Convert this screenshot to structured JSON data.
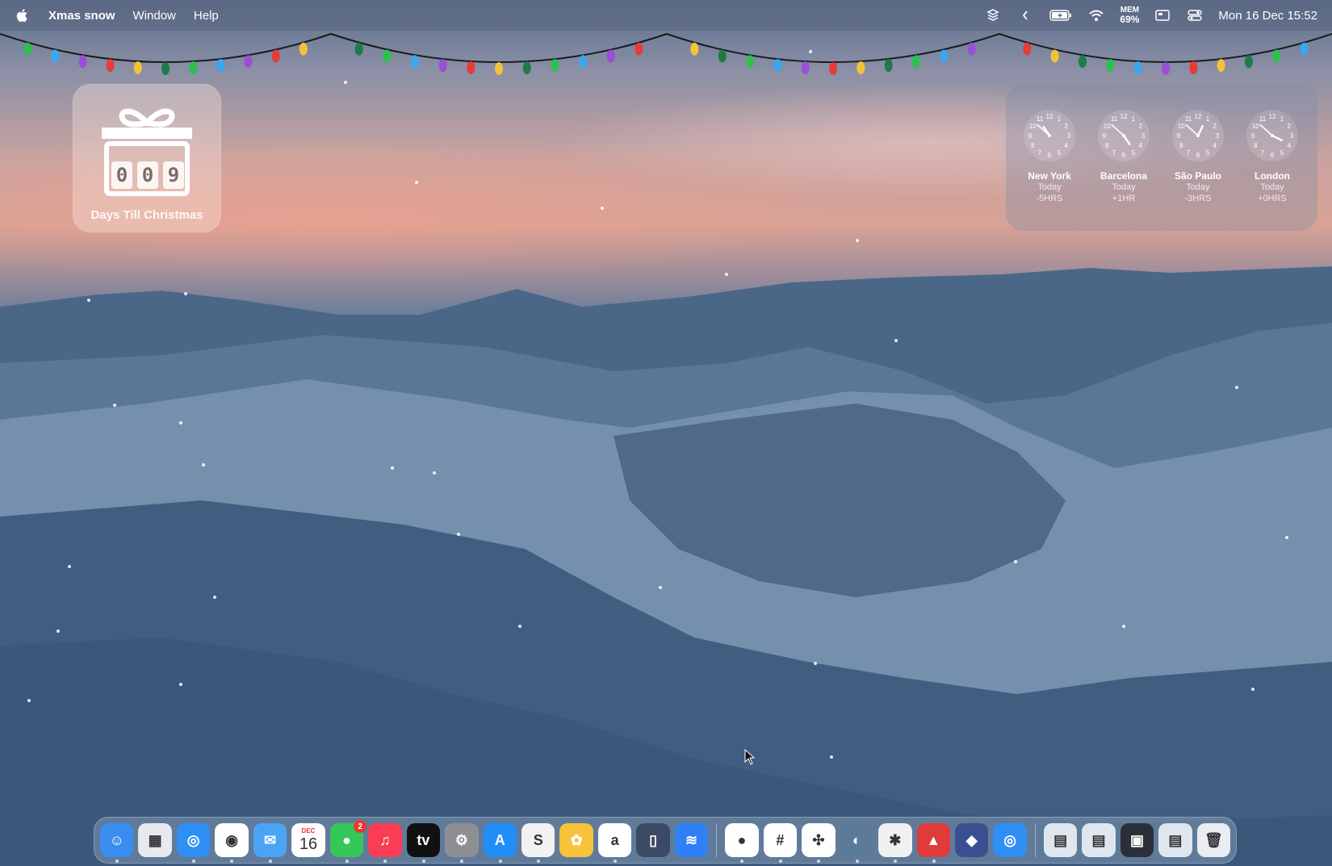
{
  "menubar": {
    "app_name": "Xmas snow",
    "menus": [
      "Window",
      "Help"
    ],
    "mem_label": "MEM",
    "mem_value": "69%",
    "datetime": "Mon 16 Dec  15:52"
  },
  "xmas_widget": {
    "digits": [
      "0",
      "0",
      "9"
    ],
    "label": "Days Till Christmas"
  },
  "world_clock": {
    "cities": [
      {
        "name": "New York",
        "day": "Today",
        "offset": "-5HRS",
        "hour": 10,
        "minute": 52
      },
      {
        "name": "Barcelona",
        "day": "Today",
        "offset": "+1HR",
        "hour": 16,
        "minute": 52
      },
      {
        "name": "São Paulo",
        "day": "Today",
        "offset": "-3HRS",
        "hour": 12,
        "minute": 52
      },
      {
        "name": "London",
        "day": "Today",
        "offset": "+0HRS",
        "hour": 15,
        "minute": 52
      }
    ]
  },
  "dock": {
    "apps": [
      {
        "name": "Finder",
        "color": "#3a8df0",
        "glyph": "☺"
      },
      {
        "name": "Launchpad",
        "color": "#e8e8ef",
        "glyph": "▦"
      },
      {
        "name": "Safari",
        "color": "#2f8ff5",
        "glyph": "◎"
      },
      {
        "name": "Chrome",
        "color": "#ffffff",
        "glyph": "◉"
      },
      {
        "name": "Mail",
        "color": "#4aa4f5",
        "glyph": "✉"
      },
      {
        "name": "Calendar",
        "color": "#ffffff",
        "glyph": "16",
        "month": "DEC"
      },
      {
        "name": "Messages",
        "color": "#34c759",
        "glyph": "●",
        "badge": "2"
      },
      {
        "name": "Music",
        "color": "#fa3c54",
        "glyph": "♫"
      },
      {
        "name": "TV",
        "color": "#111111",
        "glyph": "tv"
      },
      {
        "name": "System Settings",
        "color": "#8e8e93",
        "glyph": "⚙"
      },
      {
        "name": "App Store",
        "color": "#1f8ef7",
        "glyph": "A"
      },
      {
        "name": "Scrivener",
        "color": "#f2f2f2",
        "glyph": "S"
      },
      {
        "name": "Photos",
        "color": "#f7c33a",
        "glyph": "✿"
      },
      {
        "name": "Amazon",
        "color": "#ffffff",
        "glyph": "a"
      },
      {
        "name": "iPhone Mirroring",
        "color": "#3b4b66",
        "glyph": "▯"
      },
      {
        "name": "Layers",
        "color": "#2f7ff5",
        "glyph": "≋"
      },
      {
        "name": "Asana",
        "color": "#ffffff",
        "glyph": "●"
      },
      {
        "name": "Slack",
        "color": "#ffffff",
        "glyph": "#"
      },
      {
        "name": "ChatGPT",
        "color": "#ffffff",
        "glyph": "✣"
      },
      {
        "name": "Preview",
        "color": "#5b7a99",
        "glyph": "◐"
      },
      {
        "name": "Xmas Lights",
        "color": "#f0f0f0",
        "glyph": "✱"
      },
      {
        "name": "Santa Hat",
        "color": "#e03b3b",
        "glyph": "▲"
      },
      {
        "name": "Stack",
        "color": "#3a4f8f",
        "glyph": "◆"
      },
      {
        "name": "Safari Tech",
        "color": "#2f8ff5",
        "glyph": "◎"
      },
      {
        "name": "Downloads",
        "color": "#dfe6ee",
        "glyph": "▤"
      },
      {
        "name": "Documents",
        "color": "#dfe6ee",
        "glyph": "▤"
      },
      {
        "name": "Screenshots",
        "color": "#2b2f38",
        "glyph": "▣"
      },
      {
        "name": "Applications",
        "color": "#dfe6ee",
        "glyph": "▤"
      },
      {
        "name": "Trash",
        "color": "#e9ecf0",
        "glyph": "🗑"
      }
    ]
  },
  "colors": {
    "menubar_text": "#ffffff",
    "badge": "#e8392f"
  }
}
